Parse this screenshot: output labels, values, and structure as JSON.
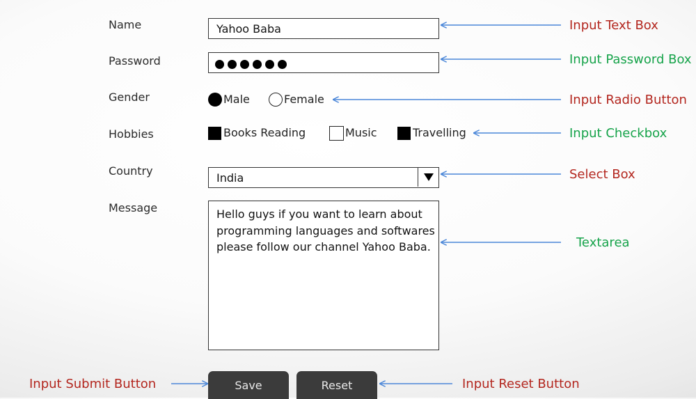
{
  "form": {
    "name_label": "Name",
    "name_value": "Yahoo Baba",
    "password_label": "Password",
    "password_length": 6,
    "gender_label": "Gender",
    "gender_options": [
      "Male",
      "Female"
    ],
    "gender_selected": "Male",
    "hobbies_label": "Hobbies",
    "hobbies": [
      {
        "label": "Books Reading",
        "checked": true
      },
      {
        "label": "Music",
        "checked": false
      },
      {
        "label": "Travelling",
        "checked": true
      }
    ],
    "country_label": "Country",
    "country_value": "India",
    "message_label": "Message",
    "message_value": "Hello guys if you want to learn about programming languages and softwares please follow our channel Yahoo Baba.",
    "save_label": "Save",
    "reset_label": "Reset"
  },
  "annotations": {
    "text_box": "Input Text Box",
    "password_box": "Input Password Box",
    "radio_button": "Input Radio Button",
    "checkbox": "Input Checkbox",
    "select_box": "Select Box",
    "textarea": "Textarea",
    "submit_button": "Input Submit Button",
    "reset_button": "Input Reset Button"
  },
  "colors": {
    "annotation_red": "#b3261e",
    "annotation_green": "#16a34a",
    "arrow_blue": "#4a86d8",
    "button_bg": "#3b3b3b"
  }
}
